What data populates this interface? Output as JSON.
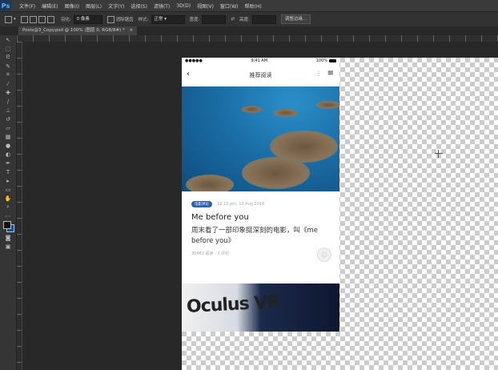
{
  "app": {
    "logo": "Ps"
  },
  "menu": [
    "文件(F)",
    "编辑(E)",
    "图像(I)",
    "图层(L)",
    "文字(Y)",
    "选择(S)",
    "滤镜(T)",
    "3D(D)",
    "视图(V)",
    "窗口(W)",
    "帮助(H)"
  ],
  "options": {
    "feather_label": "羽化:",
    "feather_value": "0 像素",
    "antialias_label": "消除锯齿",
    "style_label": "样式:",
    "style_value": "正常",
    "width_label": "宽度:",
    "height_label": "高度:",
    "refine_button": "调整边缘..."
  },
  "document_tab": {
    "title": "Posts@3_Copy.psd @ 100% (图层 0, RGB/8#) *",
    "close": "×"
  },
  "phone": {
    "status_left": "●●●●● ",
    "status_time": "9:41 AM",
    "status_right": "100%",
    "nav_title": "推荐阅读",
    "article": {
      "tag": "电影评论",
      "date": "12:10 pm, 13 Aug 2016",
      "title": "Me before you",
      "excerpt": "周末看了一部印象挺深刻的电影，叫《me before you》",
      "stats": "30482 阅读 · 3 评论"
    },
    "next_image_text": "Oculus VR"
  }
}
